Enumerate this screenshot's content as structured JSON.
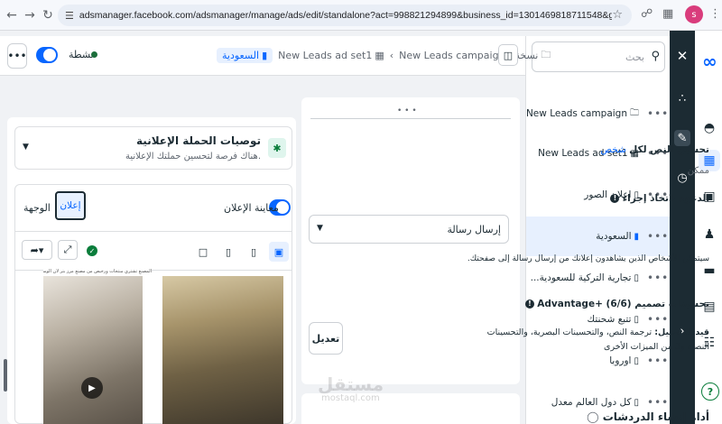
{
  "browser": {
    "url": "adsmanager.facebook.com/adsmanager/manage/ads/edit/standalone?act=998821294899&business_id=1301469818711548&global_scope_id=1301469818...",
    "profile_initial": "s"
  },
  "search": {
    "placeholder": "بحث"
  },
  "tree": {
    "items": [
      {
        "label": "New Leads campaign - نسخة",
        "icon": "folder-icon"
      },
      {
        "label": "New Leads ad set1",
        "icon": "grid-icon"
      },
      {
        "label": "اعلان الصور",
        "icon": "ad-icon"
      },
      {
        "label": "السعودية",
        "icon": "ad-icon",
        "selected": true
      },
      {
        "label": "تجارية التركية للسعودية...",
        "icon": "ad-icon"
      },
      {
        "label": "تتبع شحنتك",
        "icon": "ad-icon"
      },
      {
        "label": "اوروبا",
        "icon": "ad-icon"
      },
      {
        "label": "كل دول العالم معدل",
        "icon": "ad-icon"
      }
    ]
  },
  "toolbar": {
    "status_label": "نشطة",
    "more": "•••",
    "breadcrumb": {
      "current": "السعودية",
      "adset": "New Leads ad set1",
      "campaign": "New Leads campaign - نسخة"
    }
  },
  "editor": {
    "text_optimize_title": "تحسين النص لكل",
    "text_optimize_link": "شخص",
    "text_optimize_sub": "ممكن",
    "cta_title": "الدعوة لاتخاذ إجراء",
    "cta_value": "إرسال رسالة",
    "cta_help": "سيتمكن الأشخاص الذين يشاهدون إعلانك من إرسال رسالة إلى صفحتك.",
    "advantage_title": "تحسينات تصميم Advantage+ (6/6)",
    "advantage_line1_bold": "قيد التشغيل:",
    "advantage_line1": " ترجمة النص، والتحسينات البصرية، والتحسينات",
    "advantage_line2": "النصية و3 من الميزات الأخرى",
    "edit_button": "تعديل",
    "chat_tool_title": "أداة إنشاء الدردشات"
  },
  "preview": {
    "rec_title": "توصيات الحملة الإعلانية",
    "rec_desc": "هناك فرصة لتحسين حملتك الإعلانية.",
    "preview_toggle": "معاينة الإعلان",
    "tab_ad": "إعلان",
    "tab_destination": "الوجهة",
    "caption": "المصنع تشتري منتجات ورخيص من مصنع مرز بتر لأن الوسيط سيزيد لكم تكاليف"
  },
  "watermark": {
    "main": "مستقل",
    "sub": "mostaql.com"
  },
  "colors": {
    "accent": "#0866ff",
    "active_green": "#1b6e3b",
    "dark_rail": "#1c2b33"
  }
}
